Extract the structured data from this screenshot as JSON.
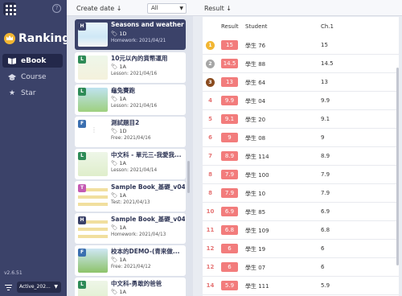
{
  "sidebar": {
    "help_label": "?",
    "brand": "Ranking",
    "nav": [
      {
        "label": "eBook",
        "icon": "book-icon",
        "active": true
      },
      {
        "label": "Course",
        "icon": "graduation-cap-icon",
        "active": false
      },
      {
        "label": "Star",
        "icon": "star-icon",
        "active": false
      }
    ],
    "version": "v2.6.51",
    "status_select": "Active_202..."
  },
  "list_panel": {
    "sort_label": "Create date ↓",
    "filter_value": "All",
    "cards": [
      {
        "tag": "H",
        "tag_color": "#3b4269",
        "title": "Seasons and weather",
        "class": "1D",
        "meta": "Homework: 2021/04/21",
        "active": true
      },
      {
        "tag": "L",
        "tag_color": "#2e8b57",
        "title": "10元以內的貨幣運用",
        "class": "1A",
        "meta": "Lesson: 2021/04/16",
        "active": false
      },
      {
        "tag": "L",
        "tag_color": "#2e8b57",
        "title": "龜兔賽跑",
        "class": "1A",
        "meta": "Lesson: 2021/04/16",
        "active": false
      },
      {
        "tag": "F",
        "tag_color": "#3b6fb0",
        "title": "測試題目2",
        "class": "1D",
        "meta": "Free: 2021/04/16",
        "active": false
      },
      {
        "tag": "L",
        "tag_color": "#2e8b57",
        "title": "中文科 - 單元三-我愛我...",
        "class": "1A",
        "meta": "Lesson: 2021/04/14",
        "active": false
      },
      {
        "tag": "T",
        "tag_color": "#c45ab3",
        "title": "Sample Book_基礎_v04",
        "class": "1A",
        "meta": "Test: 2021/04/13",
        "active": false
      },
      {
        "tag": "H",
        "tag_color": "#3b4269",
        "title": "Sample Book_基礎_v04",
        "class": "1A",
        "meta": "Homework: 2021/04/13",
        "active": false
      },
      {
        "tag": "F",
        "tag_color": "#3b6fb0",
        "title": "校本的DEMO-(青來做...",
        "class": "1A",
        "meta": "Free: 2021/04/12",
        "active": false
      },
      {
        "tag": "L",
        "tag_color": "#2e8b57",
        "title": "中文科-勇敢的爸爸",
        "class": "1A",
        "meta": "",
        "active": false
      }
    ]
  },
  "results": {
    "heading": "Result ↓",
    "columns": {
      "result": "Result",
      "student": "Student",
      "ch1": "Ch.1"
    },
    "rows": [
      {
        "rank": "1",
        "score": "15",
        "student": "學生 76",
        "ch1": "15"
      },
      {
        "rank": "2",
        "score": "14.5",
        "student": "學生 88",
        "ch1": "14.5"
      },
      {
        "rank": "3",
        "score": "13",
        "student": "學生 64",
        "ch1": "13"
      },
      {
        "rank": "4",
        "score": "9.9",
        "student": "學生 04",
        "ch1": "9.9"
      },
      {
        "rank": "5",
        "score": "9.1",
        "student": "學生 20",
        "ch1": "9.1"
      },
      {
        "rank": "6",
        "score": "9",
        "student": "學生 08",
        "ch1": "9"
      },
      {
        "rank": "7",
        "score": "8.9",
        "student": "學生 114",
        "ch1": "8.9"
      },
      {
        "rank": "8",
        "score": "7.9",
        "student": "學生 100",
        "ch1": "7.9"
      },
      {
        "rank": "8",
        "score": "7.9",
        "student": "學生 10",
        "ch1": "7.9"
      },
      {
        "rank": "10",
        "score": "6.9",
        "student": "學生 85",
        "ch1": "6.9"
      },
      {
        "rank": "11",
        "score": "6.8",
        "student": "學生 109",
        "ch1": "6.8"
      },
      {
        "rank": "12",
        "score": "6",
        "student": "學生 19",
        "ch1": "6"
      },
      {
        "rank": "12",
        "score": "6",
        "student": "學生 07",
        "ch1": "6"
      },
      {
        "rank": "14",
        "score": "5.9",
        "student": "學生 111",
        "ch1": "5.9"
      }
    ]
  },
  "colors": {
    "sidebar": "#3b4269",
    "score_badge": "#f27c7c",
    "gold": "#f2b632",
    "silver": "#a6a6a6",
    "bronze": "#8a4b1f"
  }
}
